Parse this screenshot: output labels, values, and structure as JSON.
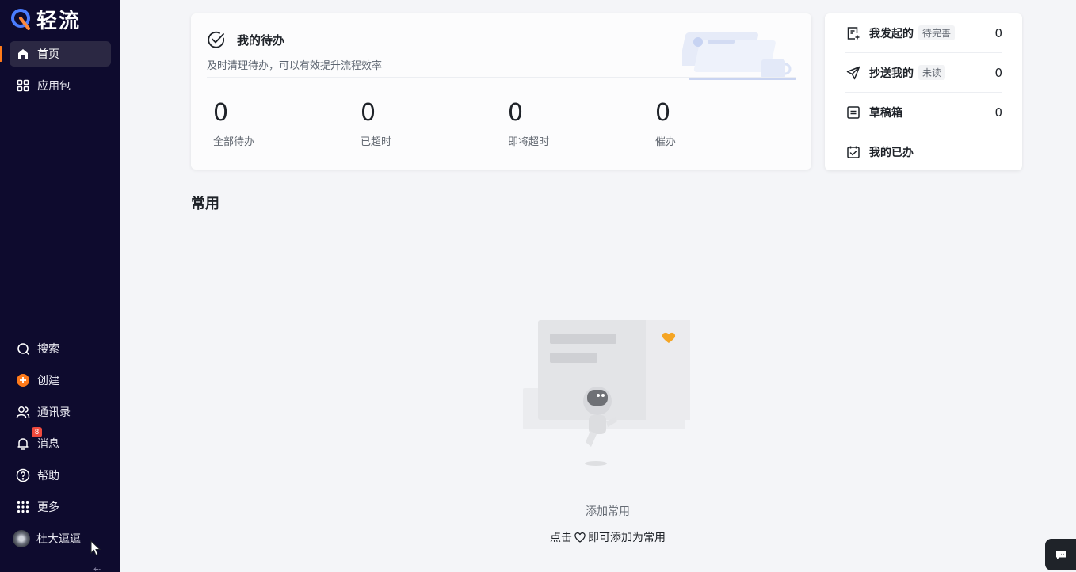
{
  "app": {
    "name": "轻流"
  },
  "sidebar": {
    "top_items": [
      {
        "label": "首页",
        "icon": "home-icon",
        "active": true
      },
      {
        "label": "应用包",
        "icon": "grid-icon",
        "active": false
      }
    ],
    "bottom_items": [
      {
        "label": "搜索",
        "icon": "search-icon"
      },
      {
        "label": "创建",
        "icon": "plus-circle-icon"
      },
      {
        "label": "通讯录",
        "icon": "contacts-icon"
      },
      {
        "label": "消息",
        "icon": "bell-icon",
        "badge": "8"
      },
      {
        "label": "帮助",
        "icon": "help-icon"
      },
      {
        "label": "更多",
        "icon": "apps-icon"
      }
    ],
    "user": {
      "name": "杜大逗逗"
    }
  },
  "todo": {
    "title": "我的待办",
    "subtitle": "及时清理待办，可以有效提升流程效率",
    "stats": [
      {
        "value": "0",
        "label": "全部待办"
      },
      {
        "value": "0",
        "label": "已超时"
      },
      {
        "value": "0",
        "label": "即将超时"
      },
      {
        "value": "0",
        "label": "催办"
      }
    ]
  },
  "side_panel": {
    "rows": [
      {
        "label": "我发起的",
        "tag": "待完善",
        "count": "0",
        "icon": "doc-add-icon"
      },
      {
        "label": "抄送我的",
        "tag": "未读",
        "count": "0",
        "icon": "send-icon"
      },
      {
        "label": "草稿箱",
        "tag": "",
        "count": "0",
        "icon": "draft-icon"
      },
      {
        "label": "我的已办",
        "tag": "",
        "count": "",
        "icon": "calendar-check-icon"
      }
    ]
  },
  "common": {
    "title": "常用",
    "empty_title": "添加常用",
    "hint_before": "点击",
    "hint_after": "即可添加为常用"
  },
  "colors": {
    "sidebar_bg": "#0e0b2e",
    "accent": "#ff7a1a",
    "badge": "#f04a3d"
  }
}
